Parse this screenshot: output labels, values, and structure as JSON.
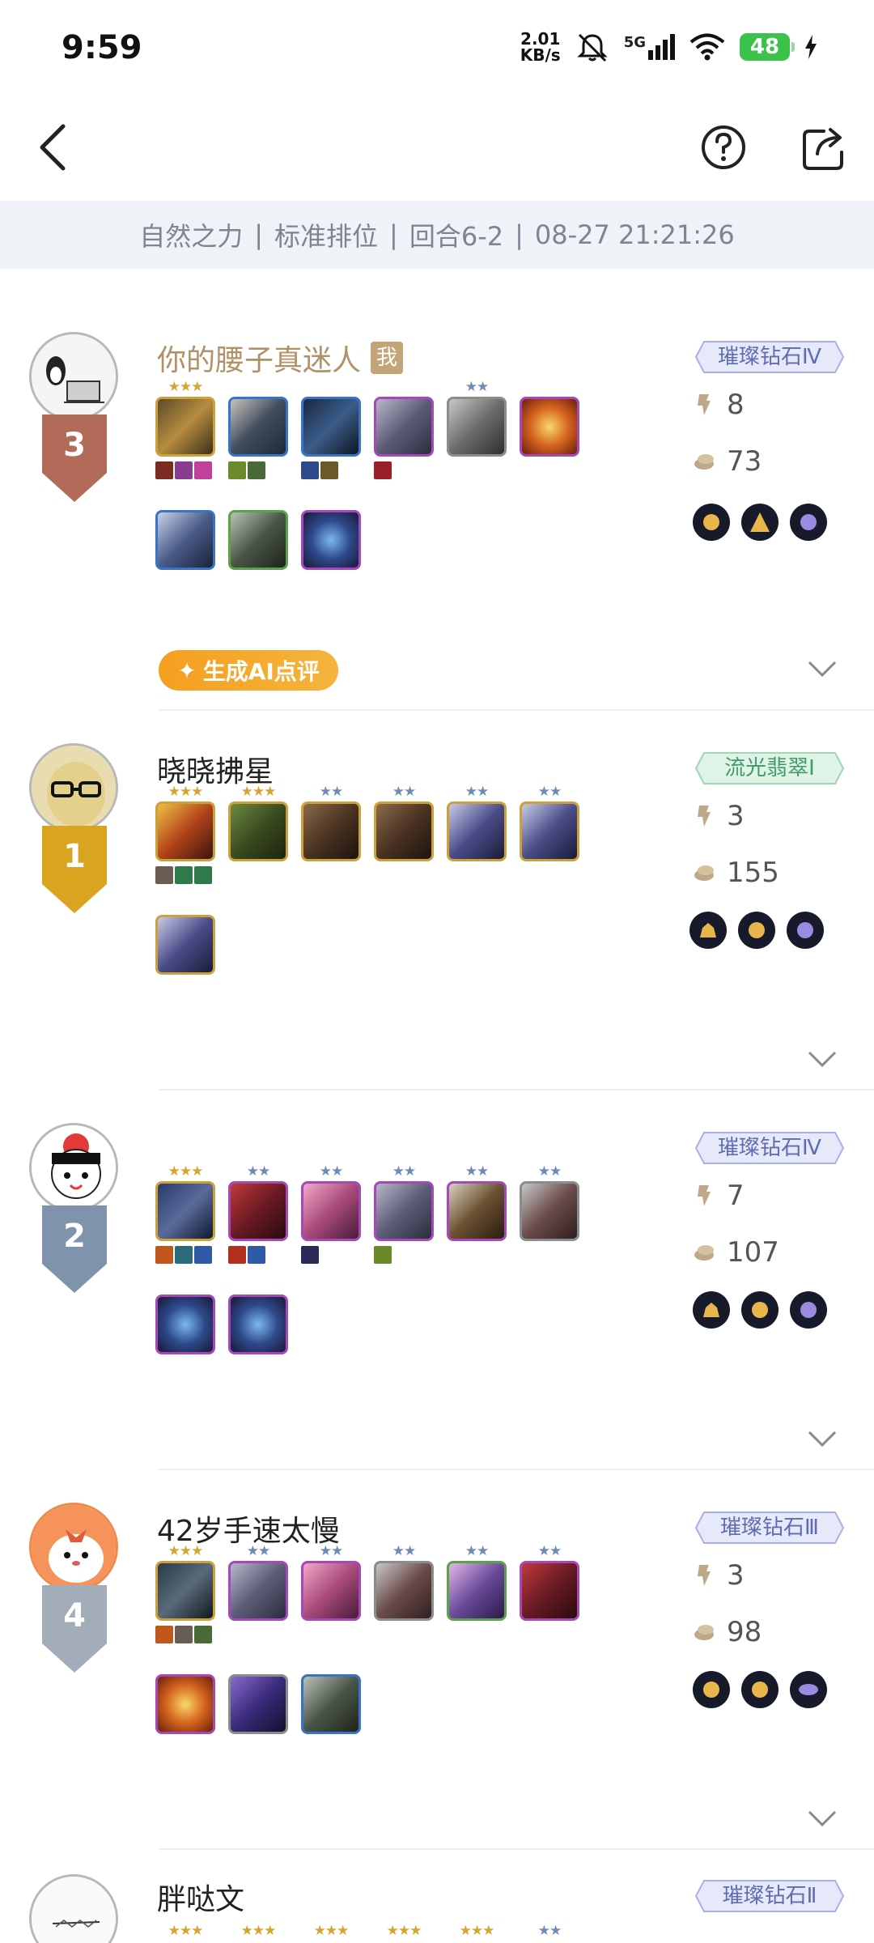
{
  "status_bar": {
    "time": "9:59",
    "net_speed_top": "2.01",
    "net_speed_bottom": "KB/s",
    "network": "5G",
    "battery": "48"
  },
  "nav": {
    "back_icon": "chevron-left-icon",
    "help_icon": "question-circle-icon",
    "share_icon": "share-icon"
  },
  "match_info": {
    "mode": "自然之力",
    "queue": "标准排位",
    "round": "回合6-2",
    "time": "08-27 21:21:26",
    "separator": "|"
  },
  "ai_review": {
    "label": "生成AI点评"
  },
  "players": [
    {
      "name": "你的腰子真迷人",
      "me_tag": "我",
      "placement": "3",
      "tier": "璀璨钻石Ⅳ",
      "level": "8",
      "gold": "73"
    },
    {
      "name": "晓晓拂星",
      "placement": "1",
      "tier": "流光翡翠Ⅰ",
      "level": "3",
      "gold": "155"
    },
    {
      "name": "",
      "placement": "2",
      "tier": "璀璨钻石Ⅳ",
      "level": "7",
      "gold": "107"
    },
    {
      "name": "42岁手速太慢",
      "placement": "4",
      "tier": "璀璨钻石Ⅲ",
      "level": "3",
      "gold": "98"
    },
    {
      "name": "胖哒文",
      "placement": "",
      "tier": "璀璨钻石Ⅱ",
      "level": "",
      "gold": ""
    }
  ],
  "colors": {
    "gold_star": "#d6a531",
    "silver_star": "#6e8bb8",
    "rank1": "#d9a41f",
    "rank2": "#7f93ad",
    "rank3": "#b26b58",
    "rank4": "#a2adb9",
    "ai_button": "#f5a52a"
  }
}
